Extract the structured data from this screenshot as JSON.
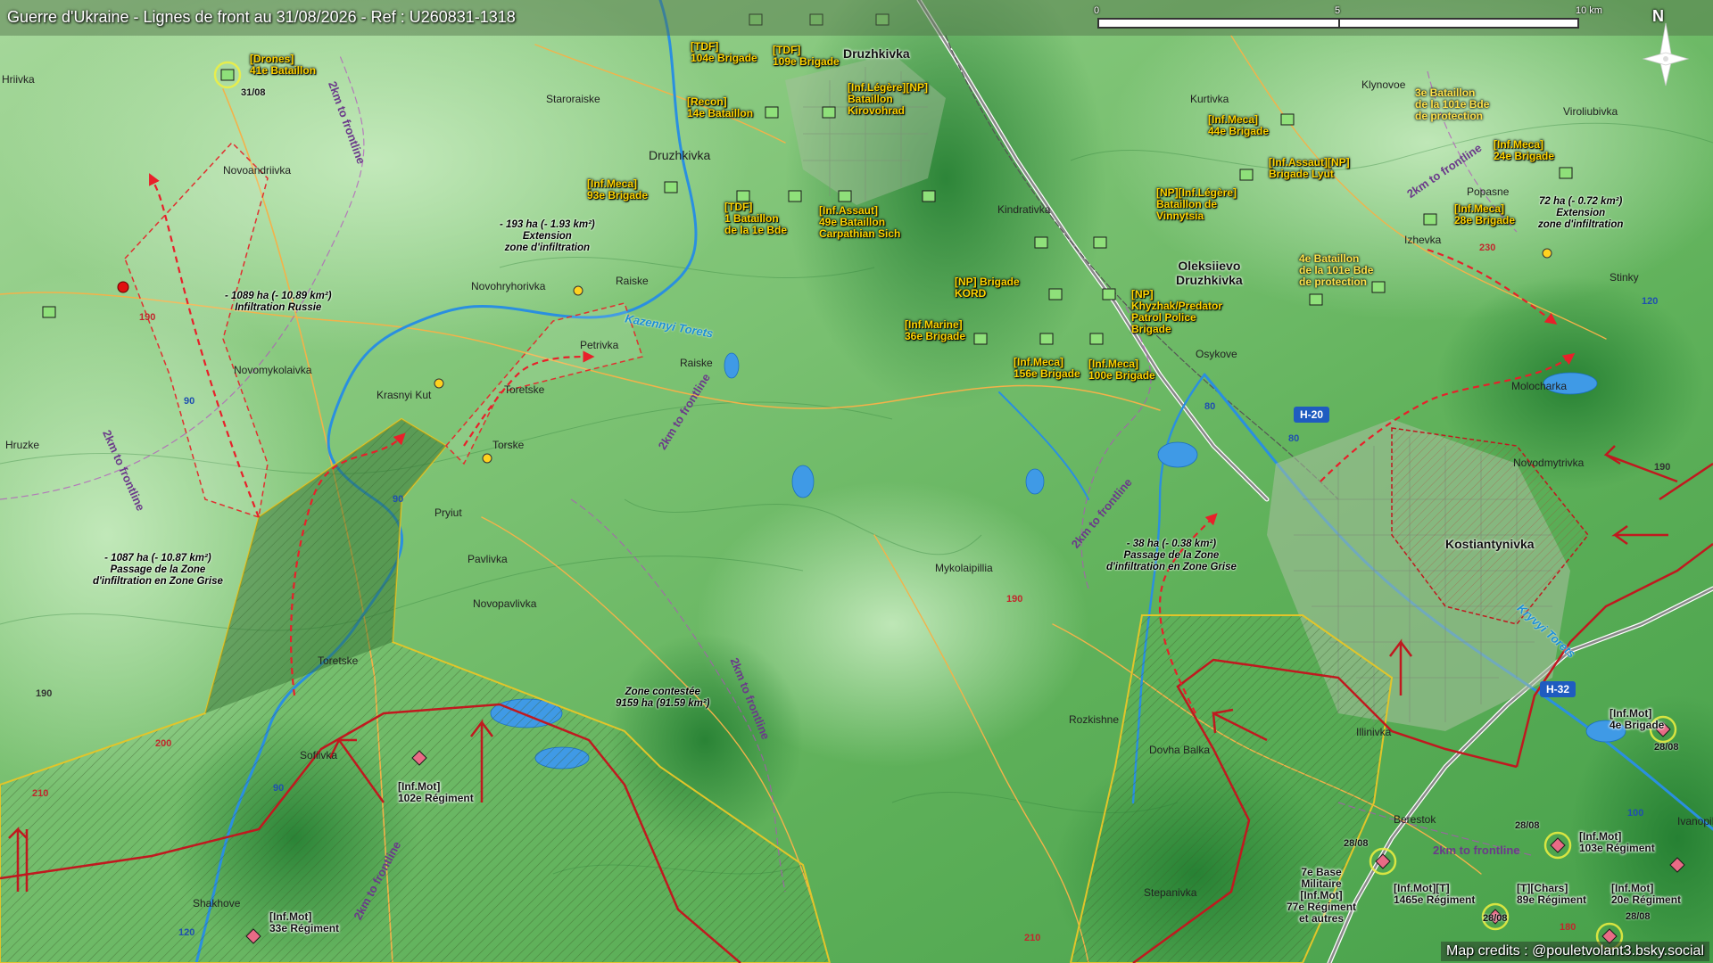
{
  "header": {
    "title": "Guerre d'Ukraine - Lignes de front au 31/08/2026 - Ref : U260831-1318"
  },
  "scale": {
    "labels": [
      "0",
      "5",
      "10 km"
    ]
  },
  "compass": {
    "label": "N"
  },
  "credits": "Map credits : @pouletvolant3.bsky.social",
  "colors": {
    "terrain_light": "#9fd69a",
    "terrain_mid": "#5fae58",
    "terrain_dark": "#2f8a3b",
    "russian_line": "#c0191f",
    "zone_border": "#e2c52a",
    "river": "#2a8fe0",
    "ukraine_unit": "#8fe07a",
    "russia_unit": "#e86b86",
    "road": "#f3b24a"
  },
  "places": {
    "p1": "Druzhkivka",
    "p2": "Druzhkivka",
    "p3": "Staroraiske",
    "p4": "Novoandriivka",
    "p5": "Novohryhorivka",
    "p6": "Raiske",
    "p7": "Raiske",
    "p8": "Petrivka",
    "p9": "Novomykolaivka",
    "p10": "Krasnyi Kut",
    "p11": "Toretske",
    "p12": "Torske",
    "p13": "Pryiut",
    "p14": "Pavlivka",
    "p15": "Novopavlivka",
    "p16": "Toretske",
    "p17": "Sofiivka",
    "p18": "Hruzke",
    "p19": "Shakhove",
    "p20": "Kindrativka",
    "p21": "Oleksiievo\nDruzhkivka",
    "p22": "Osykove",
    "p23": "Kurtivka",
    "p24": "Klynovoe",
    "p25": "Viroliubivka",
    "p26": "Popasne",
    "p27": "Izhevka",
    "p28": "Stinky",
    "p29": "Molocharka",
    "p30": "Novodmytrivka",
    "p31": "Kostiantynivka",
    "p32": "Mykolaipillia",
    "p33": "Rozkishne",
    "p34": "Dovha Balka",
    "p35": "Illinivka",
    "p36": "Stepanivka",
    "p37": "Berestok",
    "p38": "Ivanopillia",
    "p39": "Hriivka",
    "p40": "Kazennyi Torets",
    "p41": "Kryvyi Torets"
  },
  "roads": {
    "h20": "H-20",
    "h32": "H-32",
    "n80a": "80",
    "n80b": "80",
    "n90a": "90",
    "n90b": "90",
    "n90c": "90",
    "n100": "100",
    "n120a": "120",
    "n120b": "120",
    "n190a": "190",
    "n190b": "190",
    "n190c": "190",
    "n190d": "190",
    "n200": "200",
    "n210a": "210",
    "n210b": "210",
    "n230": "230",
    "n180": "180"
  },
  "frontline_labels": {
    "f1": "2km to frontline",
    "f2": "2km to frontline",
    "f3": "2km to frontline",
    "f4": "2km to frontline",
    "f5": "2km to frontline",
    "f6": "2km to frontline",
    "f7": "2km to frontline",
    "f8": "2km to frontline"
  },
  "ukraine_units": {
    "u1": "[Drones]\n41e Bataillon",
    "u2": "[TDF]\n104e Brigade",
    "u3": "[TDF]\n109e Brigade",
    "u4": "[Recon]\n14e Bataillon",
    "u5": "[Inf.Légère][NP]\nBataillon\nKirovohrad",
    "u6": "[Inf.Meca]\n93e Brigade",
    "u7": "[TDF]\n1 Bataillon\nde la 1e Bde",
    "u8": "[Inf.Assaut]\n49e Bataillon\nCarpathian Sich",
    "u9": "[Inf.Meca]\n44e Brigade",
    "u10": "[Inf.Assaut][NP]\nBrigade Lyut",
    "u11": "[NP][Inf.Légère]\nBataillon de\nVinnytsia",
    "u12": "[NP] Brigade\nKORD",
    "u13": "[NP]\nKhyzhak/Predator\nPatrol Police\nBrigade",
    "u14": "[Inf.Marine]\n36e Brigade",
    "u15": "[Inf.Meca]\n156e Brigade",
    "u16": "[Inf.Meca]\n100e Brigade",
    "u17": "3e Bataillon\nde la 101e Bde\nde protection",
    "u18": "[Inf.Meca]\n24e Brigade",
    "u19": "[Inf.Meca]\n28e Brigade",
    "u20": "4e Bataillon\nde la 101e Bde\nde protection"
  },
  "russia_units": {
    "r1": "[Inf.Mot]\n102e Régiment",
    "r2": "[Inf.Mot]\n33e Régiment",
    "r3": "[Inf.Mot]\n4e Brigade",
    "r4": "[Inf.Mot]\n103e Régiment",
    "r5": "7e Base\nMilitaire\n[Inf.Mot]\n77e Régiment\net autres",
    "r6": "[Inf.Mot][T]\n1465e Régiment",
    "r7": "[T][Chars]\n89e Régiment",
    "r8": "[Inf.Mot]\n20e Régiment"
  },
  "dates": {
    "d1": "31/08",
    "d2": "28/08",
    "d3": "28/08",
    "d4": "28/08",
    "d5": "28/08",
    "d6": "28/08"
  },
  "notes": {
    "n1": "- 193 ha (- 1.93 km²)\nExtension\nzone d'infiltration",
    "n2": "- 1089 ha (- 10.89 km²)\nInfiltration Russie",
    "n3": "- 1087 ha (- 10.87 km²)\nPassage de la Zone\nd'infiltration en Zone Grise",
    "n4": "Zone contestée\n9159 ha (91.59 km²)",
    "n5": "- 38 ha (- 0.38 km²)\nPassage de la Zone\nd'infiltration en Zone Grise",
    "n6": "72 ha (- 0.72 km²)\nExtension\nzone d'infiltration"
  }
}
